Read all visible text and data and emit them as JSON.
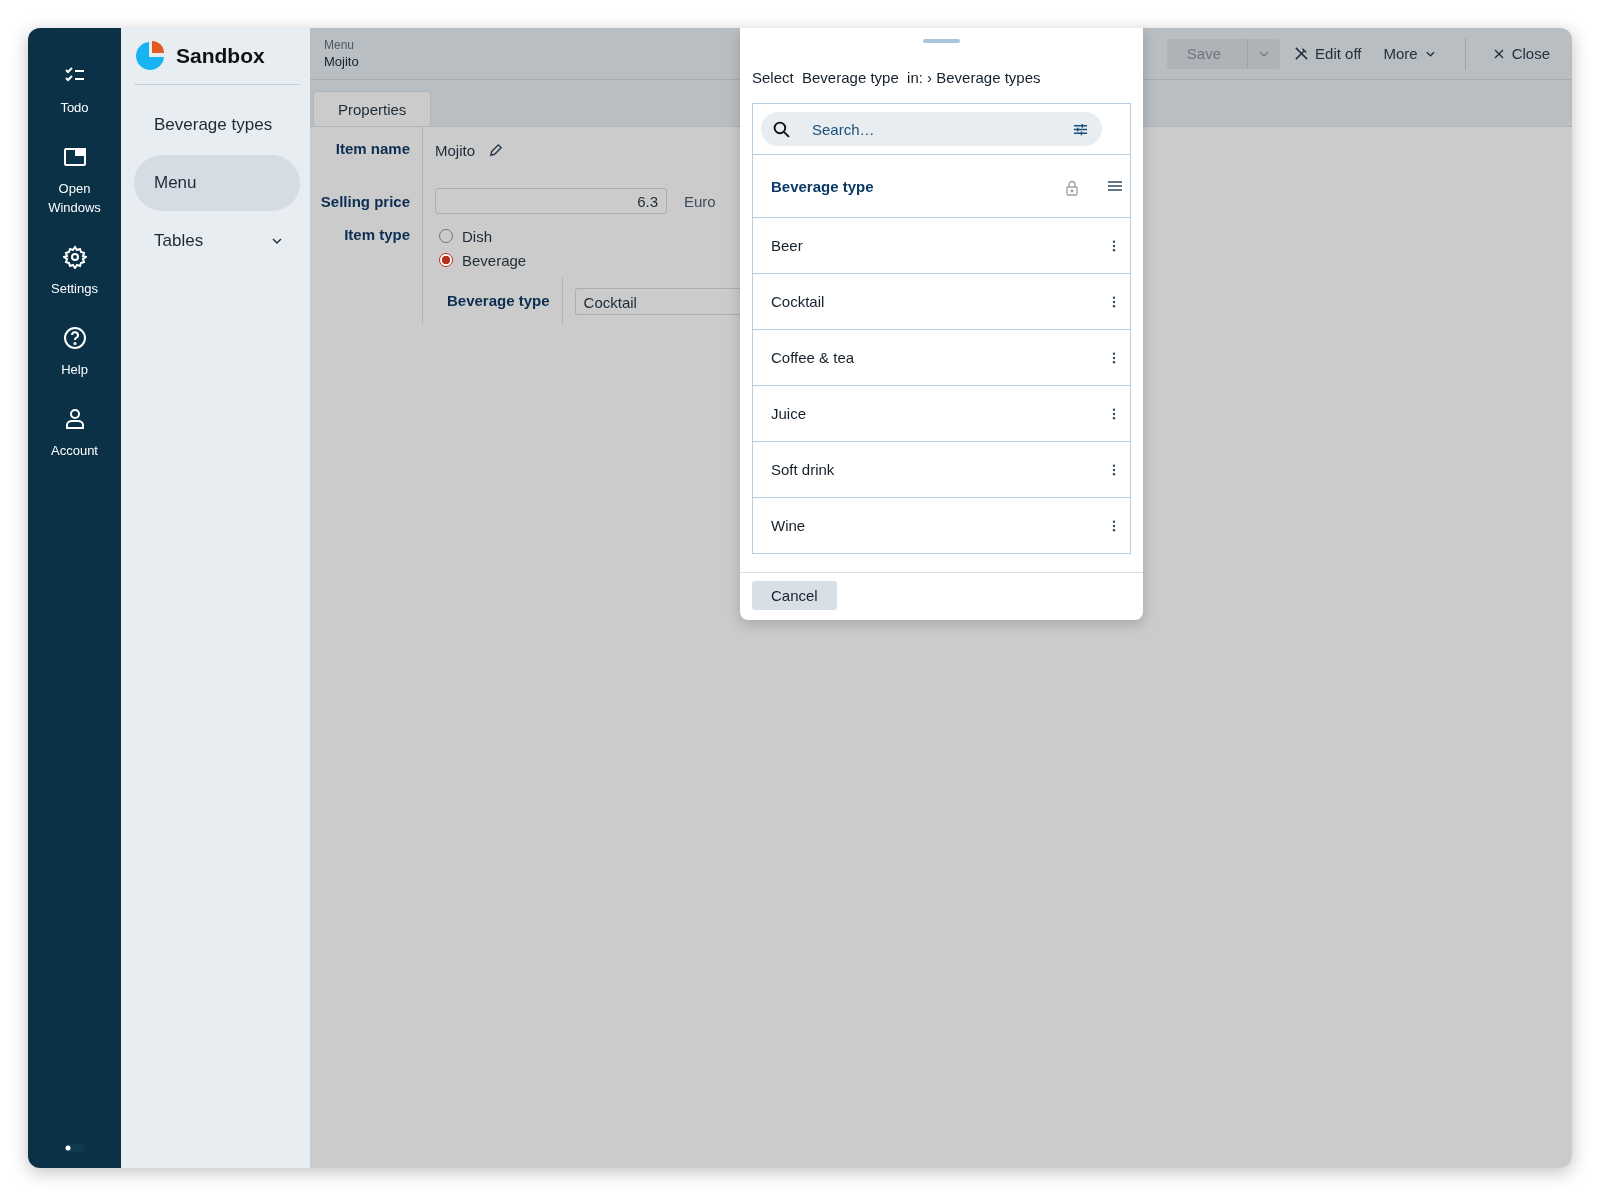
{
  "rail": {
    "items": [
      {
        "label": "Todo"
      },
      {
        "label": "Open Windows"
      },
      {
        "label": "Settings"
      },
      {
        "label": "Help"
      },
      {
        "label": "Account"
      }
    ]
  },
  "app": {
    "name": "Sandbox"
  },
  "nav": {
    "items": [
      {
        "label": "Beverage types",
        "kind": "link",
        "selected": false
      },
      {
        "label": "Menu",
        "kind": "link",
        "selected": true
      },
      {
        "label": "Tables",
        "kind": "group",
        "selected": false,
        "expanded": false
      }
    ]
  },
  "header": {
    "breadcrumb": "Menu",
    "title": "Mojito"
  },
  "toolbar": {
    "save": {
      "label": "Save",
      "disabled": true
    },
    "edit": "Edit off",
    "more": "More",
    "close": "Close"
  },
  "tabs": [
    {
      "label": "Properties",
      "selected": true
    }
  ],
  "form": {
    "item_name": {
      "label": "Item name",
      "value": "Mojito"
    },
    "selling_price": {
      "label": "Selling price",
      "value": "6.3",
      "unit": "Euro"
    },
    "item_type": {
      "label": "Item type",
      "options": [
        {
          "label": "Dish",
          "selected": false
        },
        {
          "label": "Beverage",
          "selected": true
        }
      ]
    },
    "beverage_type": {
      "label": "Beverage type",
      "value": "Cocktail"
    }
  },
  "dialog": {
    "prompt": "Select  Beverage type  in: › Beverage types",
    "search": {
      "placeholder": "Search…"
    },
    "column": "Beverage type",
    "rows": [
      "Beer",
      "Cocktail",
      "Coffee & tea",
      "Juice",
      "Soft drink",
      "Wine"
    ],
    "cancel": "Cancel"
  }
}
